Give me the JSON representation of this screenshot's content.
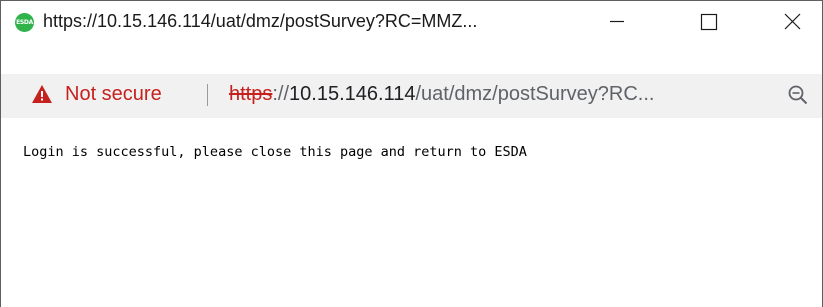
{
  "window": {
    "title": "https://10.15.146.114/uat/dmz/postSurvey?RC=MMZ...",
    "favicon_text": "ESDA",
    "favicon_color": "#2fb34a",
    "minimize_icon": "minimize-icon",
    "maximize_icon": "maximize-icon",
    "close_icon": "close-icon"
  },
  "addressbar": {
    "security_icon": "warning-triangle-icon",
    "security_label": "Not secure",
    "security_color": "#c5221f",
    "url_scheme": "https",
    "url_separator": "://",
    "url_host": "10.15.146.114",
    "url_path": "/uat/dmz/postSurvey?RC...",
    "zoom_icon": "zoom-out-icon"
  },
  "page": {
    "message": "Login is successful, please close this page and return to ESDA"
  }
}
